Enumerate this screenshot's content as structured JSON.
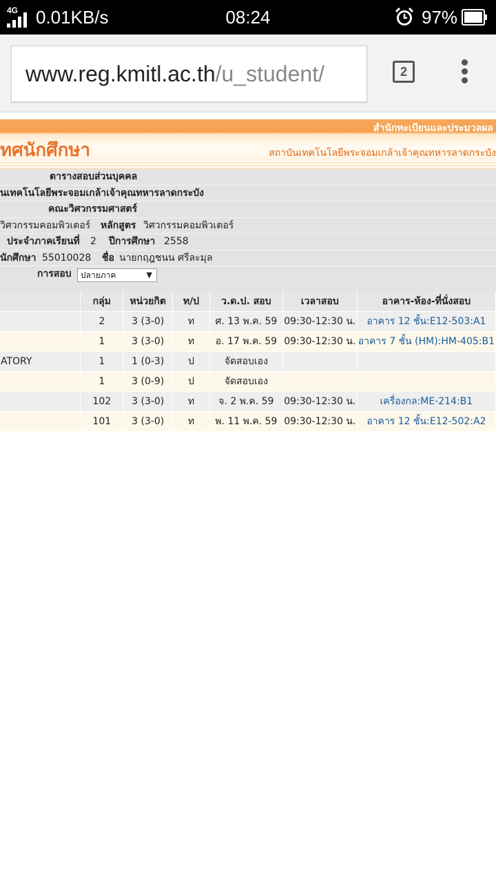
{
  "statusbar": {
    "network": "4G",
    "speed": "0.01KB/s",
    "time": "08:24",
    "battery": "97%"
  },
  "browser": {
    "url_host": "www.reg.kmitl.ac.th",
    "url_path": "/u_student/",
    "tab_count": "2"
  },
  "banner": {
    "title": "ทศนักศึกษา",
    "right_top": "สำนักทะเบียนและประมวลผล",
    "right_sub": "สถาบันเทคโนโลยีพระจอมเกล้าเจ้าคุณทหารลาดกระบัง"
  },
  "info": {
    "heading": "ตารางสอบส่วนบุคคล",
    "institute": "นเทคโนโลยีพระจอมเกล้าเจ้าคุณทหารลาดกระบัง",
    "faculty": "คณะวิศวกรรมศาสตร์",
    "dept_value": "วิศวกรรมคอมพิวเตอร์",
    "curriculum_label": "หลักสูตร",
    "curriculum_value": "วิศวกรรมคอมพิวเตอร์",
    "semester_label": "ประจำภาคเรียนที่",
    "semester_value": "2",
    "year_label": "ปีการศึกษา",
    "year_value": "2558",
    "student_id_label": "นักศึกษา",
    "student_id_value": "55010028",
    "name_label": "ชื่อ",
    "name_value": "นายกฤฎชนน ศรีละมุล",
    "exam_label": "การสอบ",
    "exam_select": "ปลายภาค"
  },
  "table": {
    "headers": [
      "กลุ่ม",
      "หน่วยกิต",
      "ท/ป",
      "ว.ด.ป. สอบ",
      "เวลาสอบ",
      "อาคาร-ห้อง-ที่นั่งสอบ"
    ],
    "rows": [
      {
        "name": "",
        "group": "2",
        "credit": "3 (3-0)",
        "type": "ท",
        "date": "ศ. 13 พ.ค. 59",
        "time": "09:30-12:30 น.",
        "room": "อาคาร 12 ชั้น:E12-503:A1"
      },
      {
        "name": "",
        "group": "1",
        "credit": "3 (3-0)",
        "type": "ท",
        "date": "อ. 17 พ.ค. 59",
        "time": "09:30-12:30 น.",
        "room": "อาคาร 7 ชั้น (HM):HM-405:B1"
      },
      {
        "name": "ATORY",
        "group": "1",
        "credit": "1 (0-3)",
        "type": "ป",
        "date": "จัดสอบเอง",
        "time": "",
        "room": ""
      },
      {
        "name": "",
        "group": "1",
        "credit": "3 (0-9)",
        "type": "ป",
        "date": "จัดสอบเอง",
        "time": "",
        "room": ""
      },
      {
        "name": "",
        "group": "102",
        "credit": "3 (3-0)",
        "type": "ท",
        "date": "จ. 2 พ.ค. 59",
        "time": "09:30-12:30 น.",
        "room": "เครื่องกล:ME-214:B1"
      },
      {
        "name": "",
        "group": "101",
        "credit": "3 (3-0)",
        "type": "ท",
        "date": "พ. 11 พ.ค. 59",
        "time": "09:30-12:30 น.",
        "room": "อาคาร 12 ชั้น:E12-502:A2"
      }
    ]
  }
}
